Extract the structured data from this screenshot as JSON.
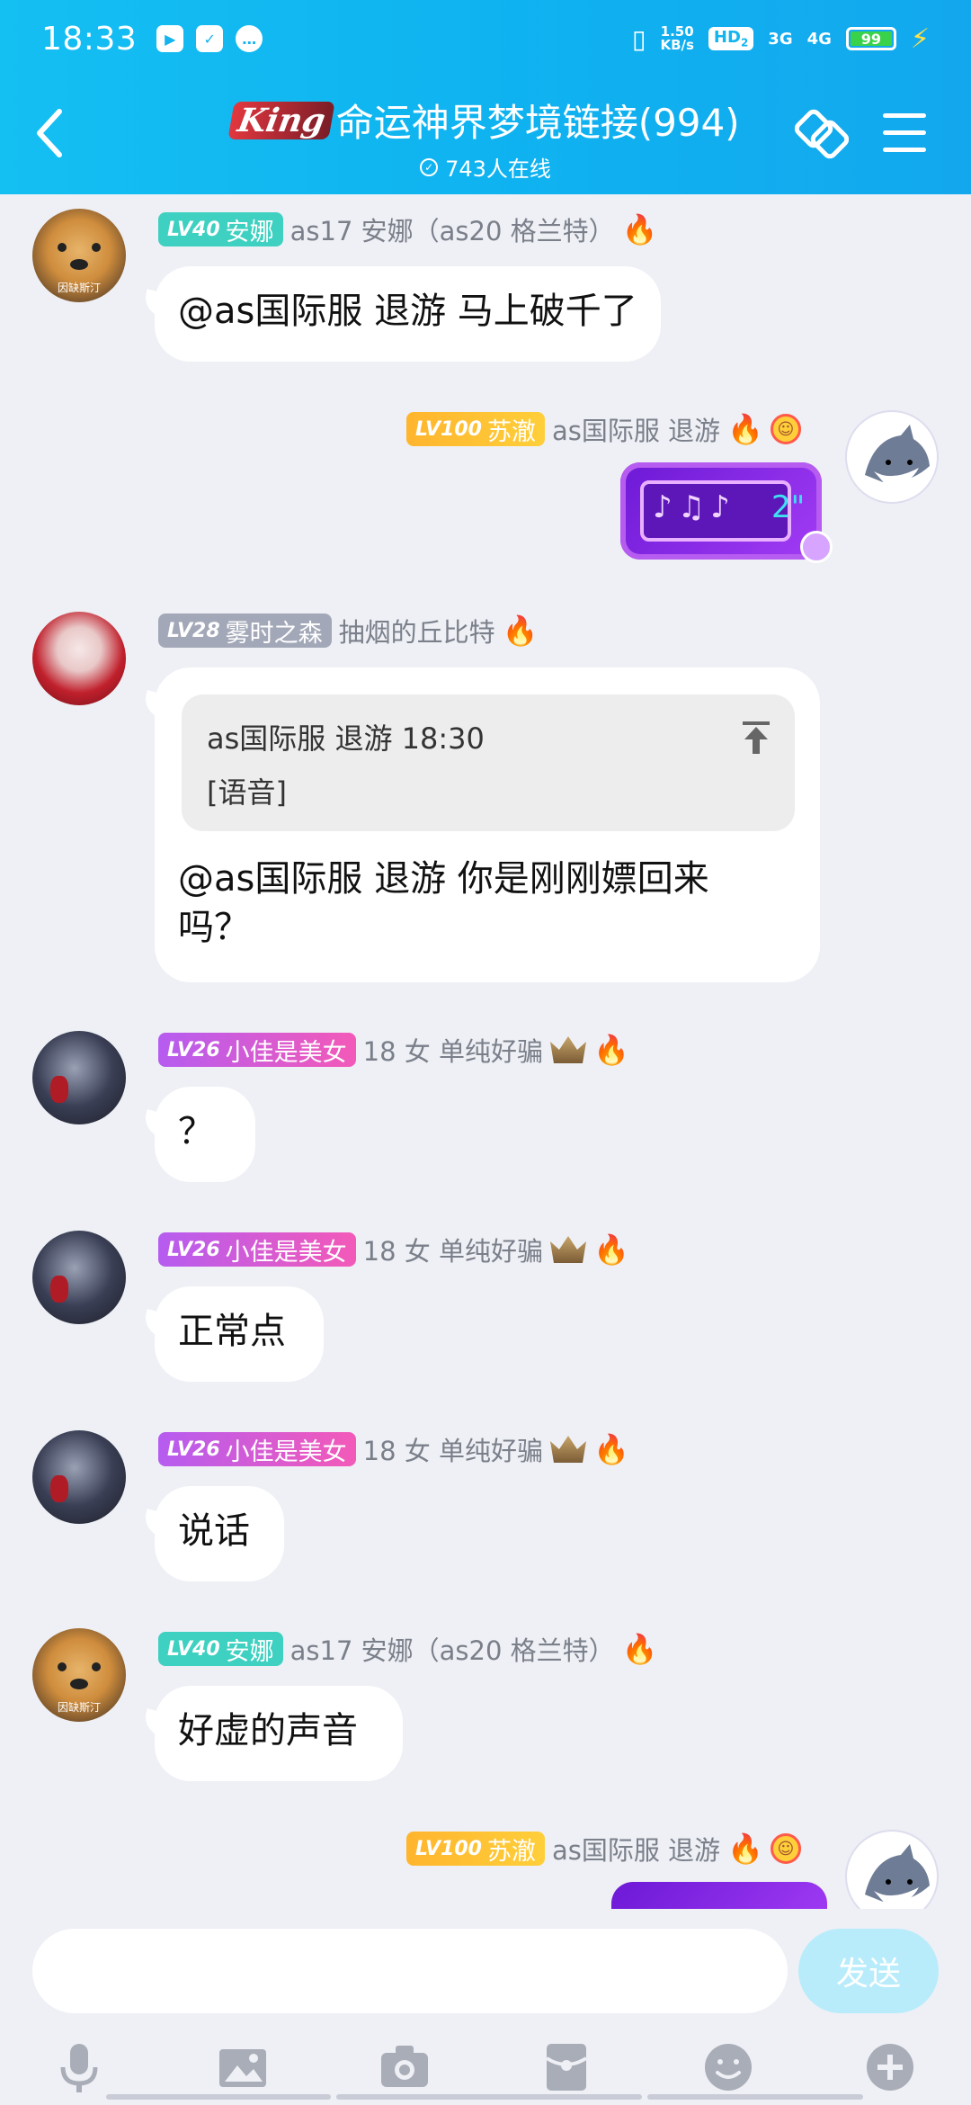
{
  "status_bar": {
    "time": "18:33",
    "net_speed_top": "1.50",
    "net_speed_bottom": "KB/s",
    "hd": "HD",
    "hd_sub": "2",
    "net1": "3G",
    "net2": "4G",
    "battery": "99"
  },
  "header": {
    "logo_text": "King",
    "title": "命运神界梦境链接(994)",
    "online": "743人在线"
  },
  "messages": [
    {
      "level": "LV40",
      "nick": "安娜",
      "name": "as17 安娜（as20 格兰特）",
      "text": "@as国际服 退游 马上破千了"
    },
    {
      "level": "LV100",
      "nick": "苏澈",
      "name": "as国际服 退游",
      "voice_duration": "2\""
    },
    {
      "level": "LV28",
      "nick": "雾时之森",
      "name": "抽烟的丘比特",
      "quote_sender": "as国际服 退游 18:30",
      "quote_content": "[语音]",
      "text_line1": "@as国际服 退游 你是刚刚嫖回来",
      "text_line2": "吗？"
    },
    {
      "level": "LV26",
      "nick": "小佳是美女",
      "name": "18 女 单纯好骗",
      "text": "？"
    },
    {
      "level": "LV26",
      "nick": "小佳是美女",
      "name": "18 女 单纯好骗",
      "text": "正常点"
    },
    {
      "level": "LV26",
      "nick": "小佳是美女",
      "name": "18 女 单纯好骗",
      "text": "说话"
    },
    {
      "level": "LV40",
      "nick": "安娜",
      "name": "as17 安娜（as20 格兰特）",
      "text": "好虚的声音"
    },
    {
      "level": "LV100",
      "nick": "苏澈",
      "name": "as国际服 退游"
    }
  ],
  "avatar_caption": "因缺斯汀",
  "input": {
    "value": "",
    "placeholder": "",
    "send_label": "发送"
  },
  "toolbar": [
    "microphone-icon",
    "image-icon",
    "camera-icon",
    "red-packet-icon",
    "emoji-icon",
    "plus-icon"
  ]
}
